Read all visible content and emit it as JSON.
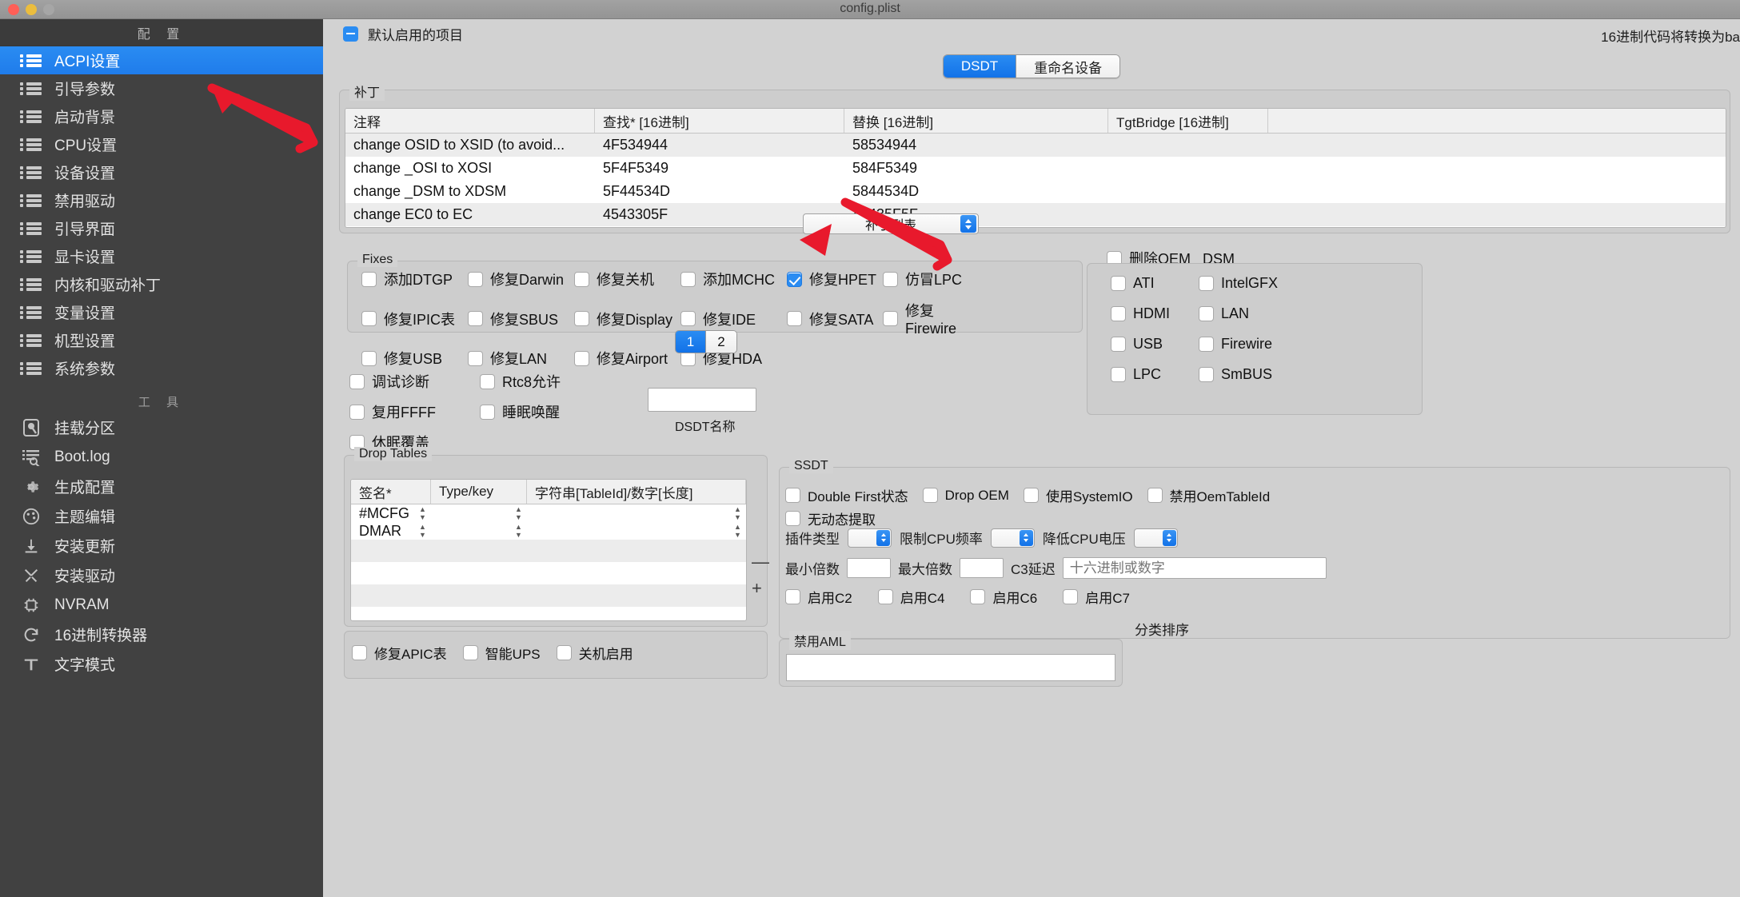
{
  "window": {
    "title": "config.plist"
  },
  "sidebar": {
    "header": "配 置",
    "items": [
      {
        "label": "ACPI设置",
        "selected": true
      },
      {
        "label": "引导参数",
        "selected": false
      },
      {
        "label": "启动背景",
        "selected": false
      },
      {
        "label": "CPU设置",
        "selected": false
      },
      {
        "label": "设备设置",
        "selected": false
      },
      {
        "label": "禁用驱动",
        "selected": false
      },
      {
        "label": "引导界面",
        "selected": false
      },
      {
        "label": "显卡设置",
        "selected": false
      },
      {
        "label": "内核和驱动补丁",
        "selected": false
      },
      {
        "label": "变量设置",
        "selected": false
      },
      {
        "label": "机型设置",
        "selected": false
      },
      {
        "label": "系统参数",
        "selected": false
      }
    ],
    "tools_header": "工 具",
    "tools": [
      {
        "label": "挂载分区",
        "icon": "disk-icon"
      },
      {
        "label": "Boot.log",
        "icon": "log-search-icon"
      },
      {
        "label": "生成配置",
        "icon": "gear-icon"
      },
      {
        "label": "主题编辑",
        "icon": "palette-icon"
      },
      {
        "label": "安装更新",
        "icon": "download-icon"
      },
      {
        "label": "安装驱动",
        "icon": "tools-icon"
      },
      {
        "label": "NVRAM",
        "icon": "chip-icon"
      },
      {
        "label": "16进制转换器",
        "icon": "refresh-icon"
      },
      {
        "label": "文字模式",
        "icon": "text-icon"
      }
    ]
  },
  "toolbar": {
    "collapse_label": "默认启用的项目",
    "right_note": "16进制代码将转换为ba"
  },
  "segmented": {
    "options": [
      "DSDT",
      "重命名设备"
    ],
    "selected": "DSDT"
  },
  "patches": {
    "group_label": "补丁",
    "columns": [
      "注释",
      "查找* [16进制]",
      "替换 [16进制]",
      "TgtBridge [16进制]"
    ],
    "rows": [
      {
        "comment": "change OSID to XSID (to avoid...",
        "find": "4F534944",
        "replace": "58534944",
        "tgt": ""
      },
      {
        "comment": "change _OSI to XOSI",
        "find": "5F4F5349",
        "replace": "584F5349",
        "tgt": ""
      },
      {
        "comment": "change _DSM to XDSM",
        "find": "5F44534D",
        "replace": "5844534D",
        "tgt": ""
      },
      {
        "comment": "change EC0 to EC",
        "find": "4543305F",
        "replace": "45435F5F",
        "tgt": ""
      }
    ],
    "list_popup": "补丁列表"
  },
  "fixes": {
    "group_label": "Fixes",
    "items": [
      {
        "label": "添加DTGP",
        "checked": false
      },
      {
        "label": "修复Darwin",
        "checked": false
      },
      {
        "label": "修复关机",
        "checked": false
      },
      {
        "label": "添加MCHC",
        "checked": false
      },
      {
        "label": "修复HPET",
        "checked": true
      },
      {
        "label": "仿冒LPC",
        "checked": false
      },
      {
        "label": "修复IPIC表",
        "checked": false
      },
      {
        "label": "修复SBUS",
        "checked": false
      },
      {
        "label": "修复Display",
        "checked": false
      },
      {
        "label": "修复IDE",
        "checked": false
      },
      {
        "label": "修复SATA",
        "checked": false
      },
      {
        "label": "修复Firewire",
        "checked": false
      },
      {
        "label": "修复USB",
        "checked": false
      },
      {
        "label": "修复LAN",
        "checked": false
      },
      {
        "label": "修复Airport",
        "checked": false
      },
      {
        "label": "修复HDA",
        "checked": false
      }
    ],
    "pages": [
      "1",
      "2"
    ],
    "current_page": "1"
  },
  "oem_dsm": {
    "title": "删除OEM _DSM",
    "checked": false,
    "items": [
      {
        "label": "ATI",
        "checked": false
      },
      {
        "label": "IntelGFX",
        "checked": false
      },
      {
        "label": "HDMI",
        "checked": false
      },
      {
        "label": "LAN",
        "checked": false
      },
      {
        "label": "USB",
        "checked": false
      },
      {
        "label": "Firewire",
        "checked": false
      },
      {
        "label": "LPC",
        "checked": false
      },
      {
        "label": "SmBUS",
        "checked": false
      }
    ]
  },
  "misc_options": {
    "left": [
      {
        "label": "调试诊断",
        "checked": false
      },
      {
        "label": "复用FFFF",
        "checked": false
      },
      {
        "label": "休眠覆盖",
        "checked": false
      }
    ],
    "right": [
      {
        "label": "Rtc8允许",
        "checked": false
      },
      {
        "label": "睡眠唤醒",
        "checked": false
      }
    ],
    "dsdt_name_label": "DSDT名称",
    "dsdt_name_value": ""
  },
  "drop_tables": {
    "group_label": "Drop Tables",
    "columns": [
      "签名*",
      "Type/key",
      "字符串[TableId]/数字[长度]"
    ],
    "rows": [
      {
        "sig": "#MCFG",
        "type": "",
        "val": ""
      },
      {
        "sig": "DMAR",
        "type": "",
        "val": ""
      }
    ],
    "remove_button": "—",
    "add_button": "+"
  },
  "ssdt": {
    "group_label": "SSDT",
    "row1": [
      {
        "label": "Double First状态",
        "checked": false
      },
      {
        "label": "Drop OEM",
        "checked": false
      },
      {
        "label": "使用SystemIO",
        "checked": false
      },
      {
        "label": "禁用OemTableId",
        "checked": false
      }
    ],
    "row2": [
      {
        "label": "无动态提取",
        "checked": false
      }
    ],
    "plugin_type_label": "插件类型",
    "plugin_type_value": "",
    "cpu_limit_label": "限制CPU频率",
    "cpu_limit_value": "",
    "cpu_volt_label": "降低CPU电压",
    "cpu_volt_value": "",
    "min_multiplier_label": "最小倍数",
    "min_multiplier_value": "",
    "max_multiplier_label": "最大倍数",
    "max_multiplier_value": "",
    "c3_latency_label": "C3延迟",
    "c3_latency_placeholder": "十六进制或数字",
    "c_states": [
      {
        "label": "启用C2",
        "checked": false
      },
      {
        "label": "启用C4",
        "checked": false
      },
      {
        "label": "启用C6",
        "checked": false
      },
      {
        "label": "启用C7",
        "checked": false
      }
    ]
  },
  "bottom": {
    "checks": [
      {
        "label": "修复APIC表",
        "checked": false
      },
      {
        "label": "智能UPS",
        "checked": false
      },
      {
        "label": "关机启用",
        "checked": false
      }
    ],
    "disable_aml_label": "禁用AML",
    "sort_label": "分类排序"
  }
}
